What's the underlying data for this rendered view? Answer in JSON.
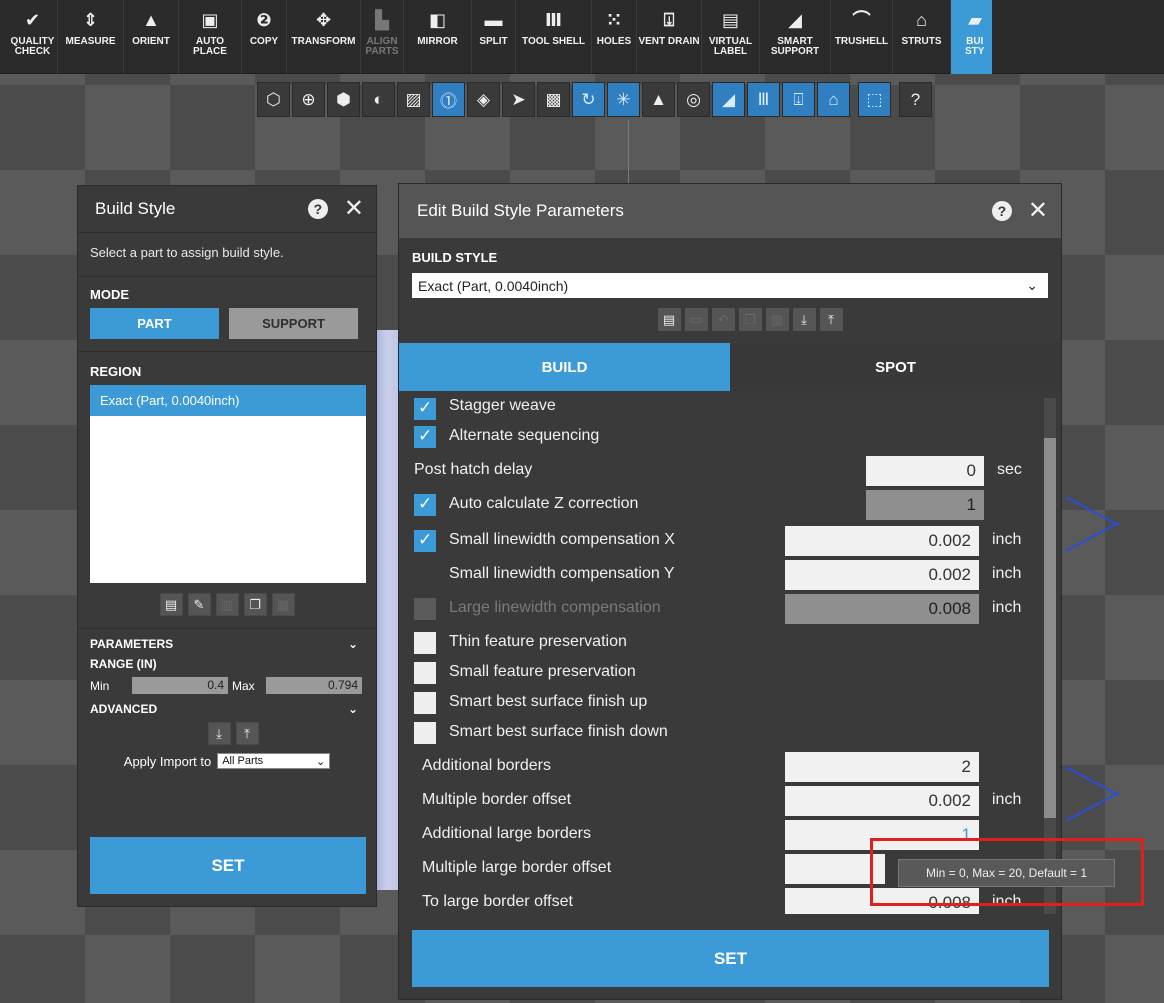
{
  "toolbar": {
    "items": [
      {
        "label": "QUALITY\nCHECK",
        "icon": "check-circle-icon"
      },
      {
        "label": "MEASURE",
        "icon": "measure-icon"
      },
      {
        "label": "ORIENT",
        "icon": "orient-icon"
      },
      {
        "label": "AUTO PLACE",
        "icon": "auto-place-icon"
      },
      {
        "label": "COPY",
        "icon": "copy-icon"
      },
      {
        "label": "TRANSFORM",
        "icon": "transform-icon"
      },
      {
        "label": "ALIGN\nPARTS",
        "icon": "align-parts-icon"
      },
      {
        "label": "MIRROR",
        "icon": "mirror-icon"
      },
      {
        "label": "SPLIT",
        "icon": "split-icon"
      },
      {
        "label": "TOOL SHELL",
        "icon": "tool-shell-icon"
      },
      {
        "label": "HOLES",
        "icon": "holes-icon"
      },
      {
        "label": "VENT DRAIN",
        "icon": "vent-drain-icon"
      },
      {
        "label": "VIRTUAL\nLABEL",
        "icon": "virtual-label-icon"
      },
      {
        "label": "SMART\nSUPPORT",
        "icon": "smart-support-icon"
      },
      {
        "label": "TRUSHELL",
        "icon": "trushell-icon"
      },
      {
        "label": "STRUTS",
        "icon": "struts-icon"
      },
      {
        "label": "BUI\nSTY",
        "icon": "build-style-icon"
      }
    ]
  },
  "build_style_panel": {
    "title": "Build Style",
    "hint": "Select a part to assign build style.",
    "mode_label": "MODE",
    "mode_part": "PART",
    "mode_support": "SUPPORT",
    "region_label": "REGION",
    "region_item": "Exact (Part, 0.0040inch)",
    "parameters_label": "PARAMETERS",
    "range_label": "RANGE (IN)",
    "min_label": "Min",
    "min_value": "0.4",
    "max_label": "Max",
    "max_value": "0.794",
    "advanced_label": "ADVANCED",
    "apply_import_label": "Apply Import to",
    "apply_import_value": "All Parts",
    "set_label": "SET"
  },
  "edit_dialog": {
    "title": "Edit Build Style Parameters",
    "build_style_label": "BUILD STYLE",
    "build_style_value": "Exact (Part, 0.0040inch)",
    "tab_build": "BUILD",
    "tab_spot": "SPOT",
    "params": {
      "stagger_weave": "Stagger weave",
      "alternate_sequencing": "Alternate sequencing",
      "post_hatch_delay": "Post hatch delay",
      "post_hatch_delay_value": "0",
      "post_hatch_delay_unit": "sec",
      "auto_z": "Auto calculate Z correction",
      "auto_z_value": "1",
      "slc_x": "Small linewidth compensation X",
      "slc_x_value": "0.002",
      "slc_x_unit": "inch",
      "slc_y": "Small linewidth compensation Y",
      "slc_y_value": "0.002",
      "slc_y_unit": "inch",
      "llc": "Large linewidth compensation",
      "llc_value": "0.008",
      "llc_unit": "inch",
      "thin_feature": "Thin feature preservation",
      "small_feature": "Small feature preservation",
      "best_up": "Smart best surface finish up",
      "best_down": "Smart best surface finish down",
      "add_borders": "Additional borders",
      "add_borders_value": "2",
      "mult_border_offset": "Multiple border offset",
      "mult_border_offset_value": "0.002",
      "mult_border_offset_unit": "inch",
      "add_large_borders": "Additional large borders",
      "add_large_borders_value": "1",
      "mult_large_border_offset": "Multiple large border offset",
      "to_large_border_offset": "To large border offset",
      "to_large_border_offset_value": "0.008",
      "to_large_border_offset_unit": "inch"
    },
    "set_label": "SET"
  },
  "tooltip": "Min = 0, Max = 20, Default = 1",
  "colors": {
    "accent": "#3c9ad6",
    "highlight": "#e01f1f"
  }
}
